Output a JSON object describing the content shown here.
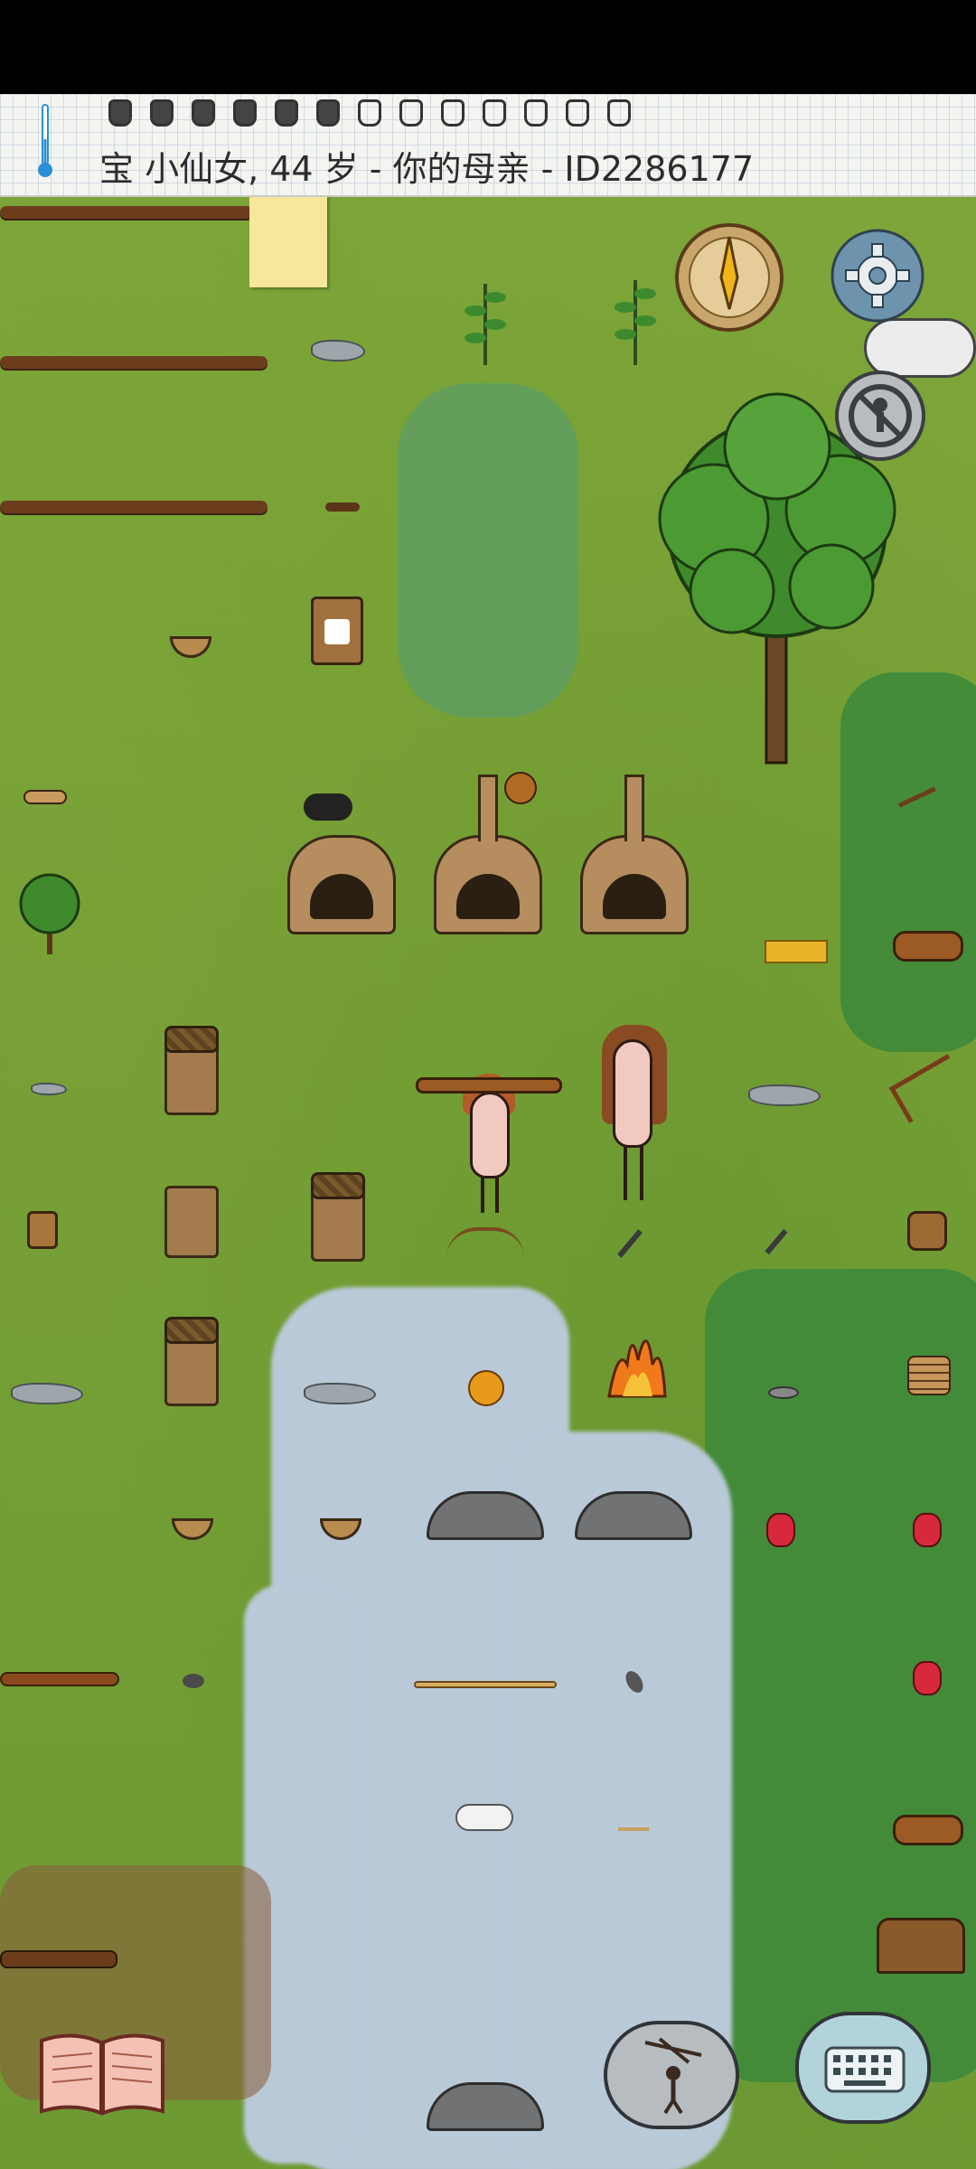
{
  "status_bar": {
    "text": "宝 小仙女, 44 岁 - 你的母亲 - ID2286177",
    "hunger": {
      "full": 6,
      "total": 13
    }
  },
  "icons": {
    "thermometer": "thermometer-icon",
    "compass": "compass-icon",
    "settings": "gear-icon",
    "mute": "no-speak-icon",
    "tech_book": "open-book-icon",
    "emote": "puppet-emote-icon",
    "keyboard": "keyboard-icon"
  },
  "colors": {
    "grass": "#7ea63a",
    "water": "#b9c9d8",
    "dark_grass": "#3f8a3a",
    "hud_paper": "#f4f5f1"
  }
}
